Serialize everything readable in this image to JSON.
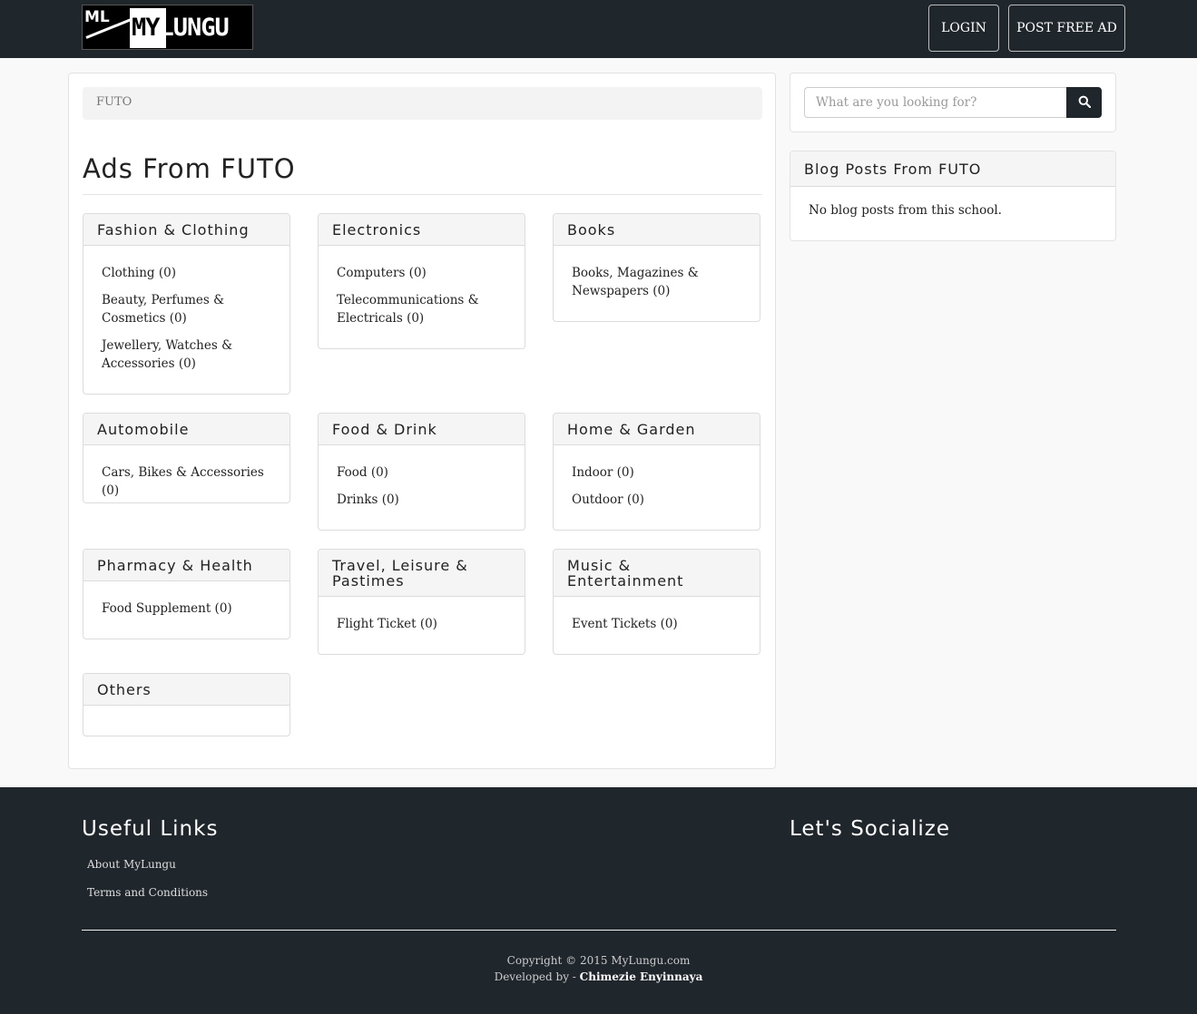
{
  "nav": {
    "logo_ml": "ML",
    "logo_my": "MY",
    "logo_lungu": "LUNGU",
    "login_label": "LOGIN",
    "post_ad_label": "POST FREE AD"
  },
  "breadcrumb": "FUTO",
  "page_title": "Ads From FUTO",
  "categories": [
    {
      "title": "Fashion & Clothing",
      "items": [
        "Clothing (0)",
        "Beauty, Perfumes & Cosmetics (0)",
        "Jewellery, Watches & Accessories (0)"
      ]
    },
    {
      "title": "Electronics",
      "items": [
        "Computers (0)",
        "Telecommunications & Electricals (0)"
      ]
    },
    {
      "title": "Books",
      "items": [
        "Books, Magazines & Newspapers (0)"
      ]
    },
    {
      "title": "Automobile",
      "items": [
        "Cars, Bikes & Accessories (0)"
      ]
    },
    {
      "title": "Food & Drink",
      "items": [
        "Food (0)",
        "Drinks (0)"
      ]
    },
    {
      "title": "Home & Garden",
      "items": [
        "Indoor (0)",
        "Outdoor (0)"
      ]
    },
    {
      "title": "Pharmacy & Health",
      "items": [
        "Food Supplement (0)"
      ]
    },
    {
      "title": "Travel, Leisure & Pastimes",
      "items": [
        "Flight Ticket (0)"
      ]
    },
    {
      "title": "Music & Entertainment",
      "items": [
        "Event Tickets (0)"
      ]
    },
    {
      "title": "Others",
      "items": []
    }
  ],
  "search": {
    "placeholder": "What are you looking for?",
    "icon": "search-icon"
  },
  "blog": {
    "title": "Blog Posts From FUTO",
    "empty_text": "No blog posts from this school."
  },
  "footer": {
    "useful_links_title": "Useful Links",
    "links": [
      "About MyLungu",
      "Terms and Conditions"
    ],
    "social_title": "Let's Socialize",
    "copyright": "Copyright © 2015 MyLungu.com",
    "developed_by": "Developed by - ",
    "developer": "Chimezie Enyinnaya"
  },
  "colors": {
    "navbar": "#1f262c",
    "footer": "#1f262c",
    "panel_header": "#f5f5f5"
  }
}
